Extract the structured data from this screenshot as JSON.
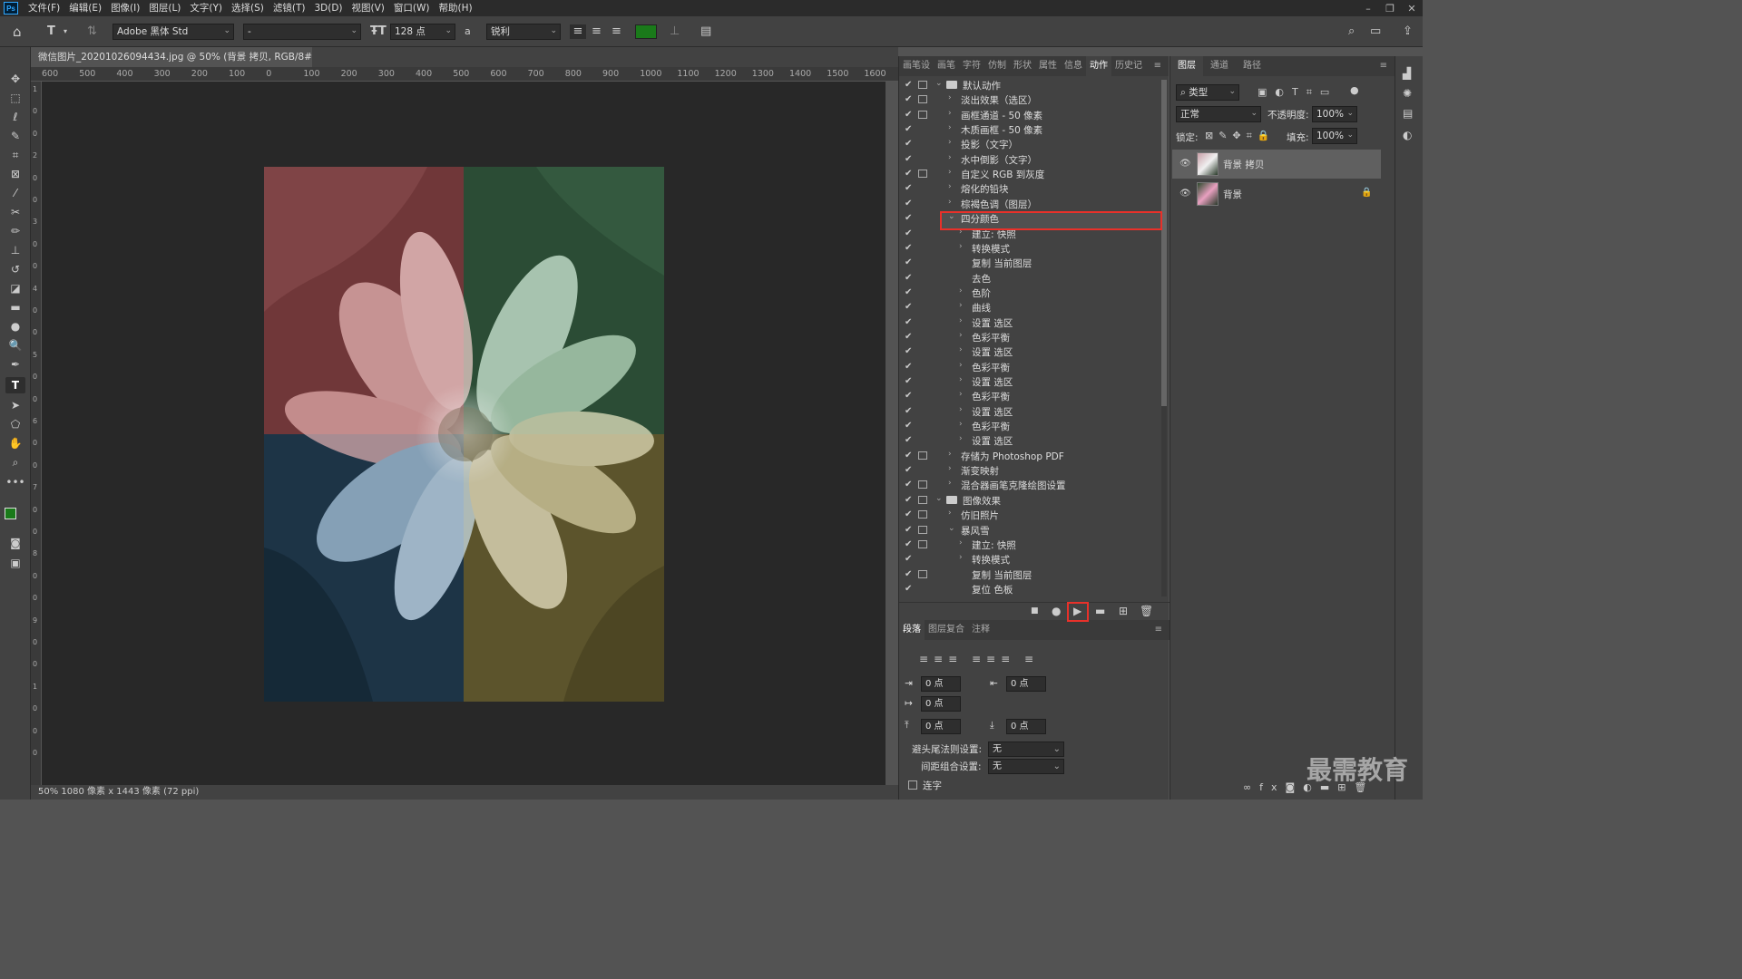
{
  "menubar": {
    "logo": "Ps",
    "items": [
      "文件(F)",
      "编辑(E)",
      "图像(I)",
      "图层(L)",
      "文字(Y)",
      "选择(S)",
      "滤镜(T)",
      "3D(D)",
      "视图(V)",
      "窗口(W)",
      "帮助(H)"
    ]
  },
  "options": {
    "font_family": "Adobe 黑体 Std",
    "font_style": "-",
    "font_size": "128 点",
    "aa_label": "a",
    "antialias": "锐利",
    "text_color": "#1a7a1a"
  },
  "document": {
    "tab_title": "微信图片_20201026094434.jpg @ 50% (背景 拷贝, RGB/8#) *",
    "status": "50%  1080 像素 x 1443 像素 (72 ppi)"
  },
  "ruler": [
    "600",
    "500",
    "400",
    "300",
    "200",
    "100",
    "0",
    "100",
    "200",
    "300",
    "400",
    "500",
    "600",
    "700",
    "800",
    "900",
    "1000",
    "1100",
    "1200",
    "1300",
    "1400",
    "1500",
    "1600"
  ],
  "vruler": [
    "1",
    "0",
    "0",
    "2",
    "0",
    "0",
    "3",
    "0",
    "0",
    "4",
    "0",
    "0",
    "5",
    "0",
    "0",
    "6",
    "0",
    "0",
    "7",
    "0",
    "0",
    "8",
    "0",
    "0",
    "9",
    "0",
    "0",
    "1",
    "0",
    "0",
    "0"
  ],
  "panels": {
    "top_tabs": [
      "画笔设",
      "画笔",
      "字符",
      "仿制",
      "形状",
      "属性",
      "信息",
      "动作",
      "历史记"
    ],
    "active_tab": "动作",
    "layer_tabs": [
      "图层",
      "通道",
      "路径"
    ]
  },
  "actions": [
    {
      "label": "默认动作",
      "indent": 0,
      "folder": true,
      "open": true,
      "dialog": true
    },
    {
      "label": "淡出效果（选区）",
      "indent": 1,
      "exp": true,
      "dialog": true
    },
    {
      "label": "画框通道 - 50 像素",
      "indent": 1,
      "exp": true,
      "dialog": true
    },
    {
      "label": "木质画框 - 50 像素",
      "indent": 1,
      "exp": true
    },
    {
      "label": "投影（文字）",
      "indent": 1,
      "exp": true
    },
    {
      "label": "水中倒影（文字）",
      "indent": 1,
      "exp": true
    },
    {
      "label": "自定义 RGB 到灰度",
      "indent": 1,
      "exp": true,
      "dialog": true
    },
    {
      "label": "熔化的铅块",
      "indent": 1,
      "exp": true
    },
    {
      "label": "棕褐色调（图层）",
      "indent": 1,
      "exp": true
    },
    {
      "label": "四分颜色",
      "indent": 1,
      "exp": true,
      "open": true
    },
    {
      "label": "建立: 快照",
      "indent": 2,
      "exp": true
    },
    {
      "label": "转换模式",
      "indent": 2,
      "exp": true
    },
    {
      "label": "复制 当前图层",
      "indent": 2
    },
    {
      "label": "去色",
      "indent": 2
    },
    {
      "label": "色阶",
      "indent": 2,
      "exp": true
    },
    {
      "label": "曲线",
      "indent": 2,
      "exp": true
    },
    {
      "label": "设置 选区",
      "indent": 2,
      "exp": true
    },
    {
      "label": "色彩平衡",
      "indent": 2,
      "exp": true
    },
    {
      "label": "设置 选区",
      "indent": 2,
      "exp": true
    },
    {
      "label": "色彩平衡",
      "indent": 2,
      "exp": true
    },
    {
      "label": "设置 选区",
      "indent": 2,
      "exp": true
    },
    {
      "label": "色彩平衡",
      "indent": 2,
      "exp": true
    },
    {
      "label": "设置 选区",
      "indent": 2,
      "exp": true
    },
    {
      "label": "色彩平衡",
      "indent": 2,
      "exp": true
    },
    {
      "label": "设置 选区",
      "indent": 2,
      "exp": true
    },
    {
      "label": "存储为 Photoshop PDF",
      "indent": 1,
      "exp": true,
      "dialog": true
    },
    {
      "label": "渐变映射",
      "indent": 1,
      "exp": true
    },
    {
      "label": "混合器画笔克隆绘图设置",
      "indent": 1,
      "exp": true,
      "dialog": true
    },
    {
      "label": "图像效果",
      "indent": 0,
      "folder": true,
      "open": true,
      "dialog": true
    },
    {
      "label": "仿旧照片",
      "indent": 1,
      "exp": true,
      "dialog": true
    },
    {
      "label": "暴风雪",
      "indent": 1,
      "exp": true,
      "open": true,
      "dialog": true
    },
    {
      "label": "建立: 快照",
      "indent": 2,
      "exp": true,
      "dialog": true
    },
    {
      "label": "转换模式",
      "indent": 2,
      "exp": true
    },
    {
      "label": "复制 当前图层",
      "indent": 2,
      "dialog": true
    },
    {
      "label": "复位 色板",
      "indent": 2
    }
  ],
  "paragraph": {
    "tabs": [
      "段落",
      "图层复合",
      "注释"
    ],
    "indent_left": "0 点",
    "indent_right": "0 点",
    "first_line": "0 点",
    "space_before": "0 点",
    "space_after": "0 点",
    "kinsoku_label": "避头尾法则设置:",
    "kinsoku_value": "无",
    "mojikumi_label": "间距组合设置:",
    "mojikumi_value": "无",
    "hyphenate": "连字"
  },
  "layers_panel": {
    "filter": "类型",
    "blend_mode": "正常",
    "opacity_label": "不透明度:",
    "opacity": "100%",
    "lock_label": "锁定:",
    "fill_label": "填充:",
    "fill": "100%",
    "layers": [
      {
        "name": "背景 拷贝",
        "selected": true,
        "locked": false
      },
      {
        "name": "背景",
        "selected": false,
        "locked": true
      }
    ]
  },
  "watermark": "最需教育",
  "colors": {
    "highlight": "#e8312a",
    "foreground": "#1a7a1a"
  }
}
